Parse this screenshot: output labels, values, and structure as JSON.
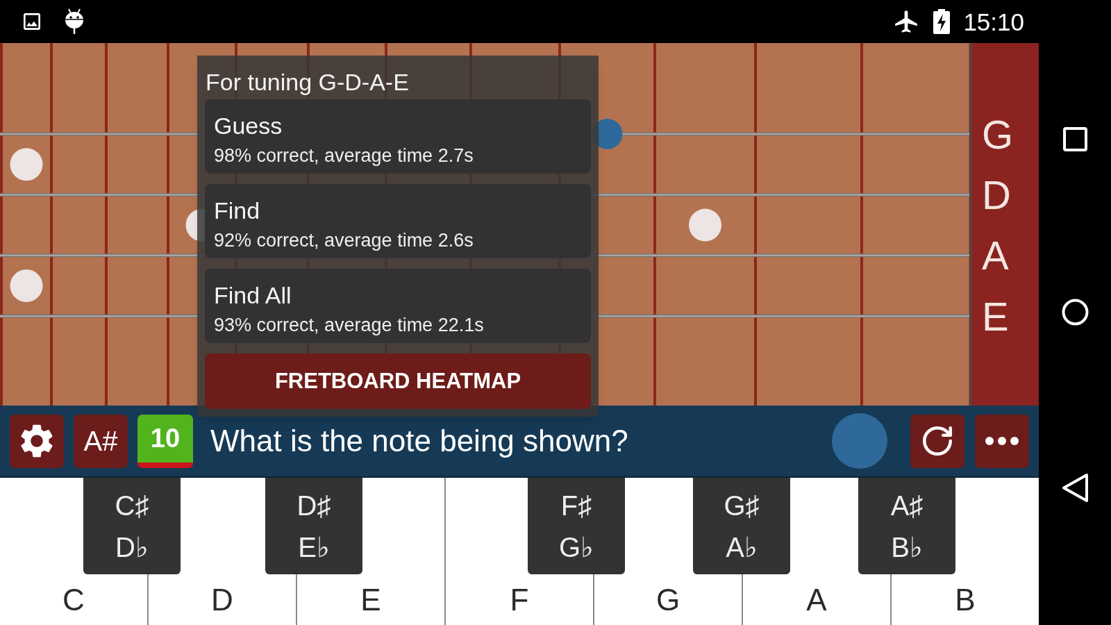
{
  "status_bar": {
    "time": "15:10"
  },
  "fretboard": {
    "strings": [
      {
        "label": "G",
        "marked": true
      },
      {
        "label": "D",
        "marked": false
      },
      {
        "label": "A",
        "marked": false
      },
      {
        "label": "E",
        "marked": false
      }
    ]
  },
  "stats_popup": {
    "title": "For tuning G-D-A-E",
    "modes": [
      {
        "name": "Guess",
        "stats": "98% correct, average time 2.7s"
      },
      {
        "name": "Find",
        "stats": "92% correct, average time 2.6s"
      },
      {
        "name": "Find All",
        "stats": "93% correct, average time 22.1s"
      }
    ],
    "button": "FRETBOARD HEATMAP"
  },
  "toolbar": {
    "accidental": "A#",
    "score": "10",
    "question": "What is the note being shown?"
  },
  "piano": {
    "white_keys": [
      "C",
      "D",
      "E",
      "F",
      "G",
      "A",
      "B"
    ],
    "black_keys": [
      {
        "sharp": "C♯",
        "flat": "D♭"
      },
      {
        "sharp": "D♯",
        "flat": "E♭"
      },
      {
        "sharp": "F♯",
        "flat": "G♭"
      },
      {
        "sharp": "G♯",
        "flat": "A♭"
      },
      {
        "sharp": "A♯",
        "flat": "B♭"
      }
    ]
  }
}
